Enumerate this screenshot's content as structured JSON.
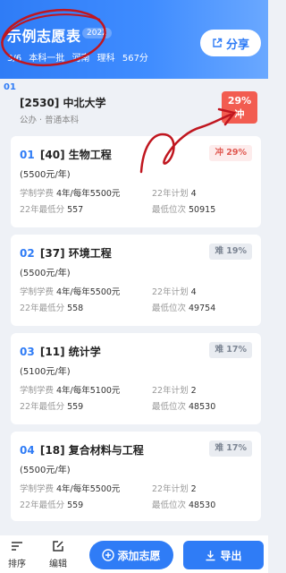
{
  "header": {
    "title": "示例志愿表",
    "year": "2022",
    "progress": "3/6",
    "batch": "本科一批",
    "province": "河南",
    "track": "理科",
    "score": "567分",
    "share_label": "分享"
  },
  "index_label": "01",
  "school": {
    "name": "[2530] 中北大学",
    "type": "公办",
    "level": "普通本科",
    "chance_pct": "29%",
    "chance_label": "冲"
  },
  "labels": {
    "duration_fee": "学制学费",
    "plan": "22年计划",
    "min_score": "22年最低分",
    "min_rank": "最低位次"
  },
  "majors": [
    {
      "num": "01",
      "name": "[40] 生物工程",
      "fee": "(5500元/年)",
      "duration_fee": "4年/每年5500元",
      "plan": "4",
      "min_score": "557",
      "min_rank": "50915",
      "chip": "冲 29%",
      "chip_type": "rush"
    },
    {
      "num": "02",
      "name": "[37] 环境工程",
      "fee": "(5500元/年)",
      "duration_fee": "4年/每年5500元",
      "plan": "4",
      "min_score": "558",
      "min_rank": "49754",
      "chip": "难 19%",
      "chip_type": "hard"
    },
    {
      "num": "03",
      "name": "[11] 统计学",
      "fee": "(5100元/年)",
      "duration_fee": "4年/每年5100元",
      "plan": "2",
      "min_score": "559",
      "min_rank": "48530",
      "chip": "难 17%",
      "chip_type": "hard"
    },
    {
      "num": "04",
      "name": "[18] 复合材料与工程",
      "fee": "(5500元/年)",
      "duration_fee": "4年/每年5500元",
      "plan": "2",
      "min_score": "559",
      "min_rank": "48530",
      "chip": "难 17%",
      "chip_type": "hard"
    }
  ],
  "bottom": {
    "sort_label": "排序",
    "edit_label": "编辑",
    "add_label": "添加志愿",
    "export_label": "导出"
  },
  "colors": {
    "accent": "#2f7cf6",
    "rush": "#f25c50",
    "annotation": "#c0161f"
  }
}
